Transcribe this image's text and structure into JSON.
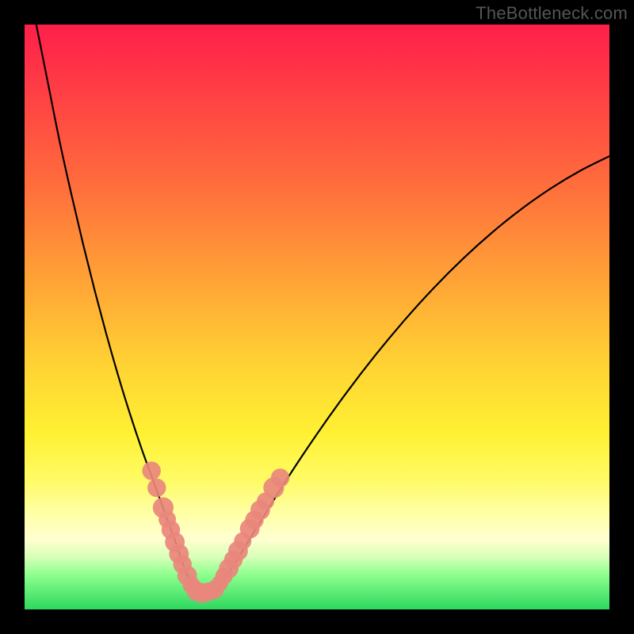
{
  "watermark": "TheBottleneck.com",
  "chart_data": {
    "type": "line",
    "title": "",
    "xlabel": "",
    "ylabel": "",
    "xlim": [
      0,
      100
    ],
    "ylim": [
      0,
      100
    ],
    "series": [
      {
        "name": "bottleneck-curve",
        "x": [
          2,
          4,
          6,
          8,
          10,
          12,
          14,
          16,
          18,
          20,
          22,
          24,
          26,
          27,
          28,
          30,
          33,
          36,
          40,
          45,
          50,
          55,
          60,
          65,
          70,
          75,
          80,
          85,
          90,
          95,
          100
        ],
        "y": [
          100,
          90,
          80,
          71,
          62.5,
          54.5,
          47,
          40,
          33.5,
          27.5,
          22,
          16.5,
          11,
          8,
          5.5,
          3,
          3.5,
          8,
          14.5,
          22.5,
          30,
          37,
          43.5,
          49.5,
          55,
          60,
          64.5,
          68.5,
          72,
          75,
          77.5
        ]
      }
    ],
    "markers": {
      "name": "highlighted-points",
      "color": "#e9877c",
      "points": [
        {
          "x": 21.7,
          "y": 23.7,
          "r": 1.1
        },
        {
          "x": 22.6,
          "y": 20.8,
          "r": 1.1
        },
        {
          "x": 23.7,
          "y": 17.4,
          "r": 1.3
        },
        {
          "x": 24.4,
          "y": 15.4,
          "r": 1.0
        },
        {
          "x": 25.0,
          "y": 13.6,
          "r": 1.1
        },
        {
          "x": 25.7,
          "y": 11.5,
          "r": 1.2
        },
        {
          "x": 26.4,
          "y": 9.5,
          "r": 1.2
        },
        {
          "x": 27.0,
          "y": 7.7,
          "r": 1.1
        },
        {
          "x": 27.8,
          "y": 5.8,
          "r": 1.2
        },
        {
          "x": 28.5,
          "y": 4.2,
          "r": 1.0
        },
        {
          "x": 29.4,
          "y": 3.1,
          "r": 1.2
        },
        {
          "x": 30.4,
          "y": 2.8,
          "r": 1.2
        },
        {
          "x": 31.4,
          "y": 3.0,
          "r": 1.1
        },
        {
          "x": 32.5,
          "y": 3.4,
          "r": 1.1
        },
        {
          "x": 33.4,
          "y": 4.5,
          "r": 0.9
        },
        {
          "x": 34.1,
          "y": 5.7,
          "r": 1.0
        },
        {
          "x": 34.9,
          "y": 7.0,
          "r": 1.2
        },
        {
          "x": 35.7,
          "y": 8.5,
          "r": 1.1
        },
        {
          "x": 36.5,
          "y": 10.0,
          "r": 1.2
        },
        {
          "x": 37.3,
          "y": 11.7,
          "r": 1.0
        },
        {
          "x": 38.5,
          "y": 13.8,
          "r": 1.2
        },
        {
          "x": 39.3,
          "y": 15.3,
          "r": 1.1
        },
        {
          "x": 40.3,
          "y": 17.0,
          "r": 1.2
        },
        {
          "x": 41.2,
          "y": 18.5,
          "r": 1.0
        },
        {
          "x": 42.6,
          "y": 20.8,
          "r": 1.3
        },
        {
          "x": 43.7,
          "y": 22.5,
          "r": 1.1
        }
      ]
    }
  }
}
